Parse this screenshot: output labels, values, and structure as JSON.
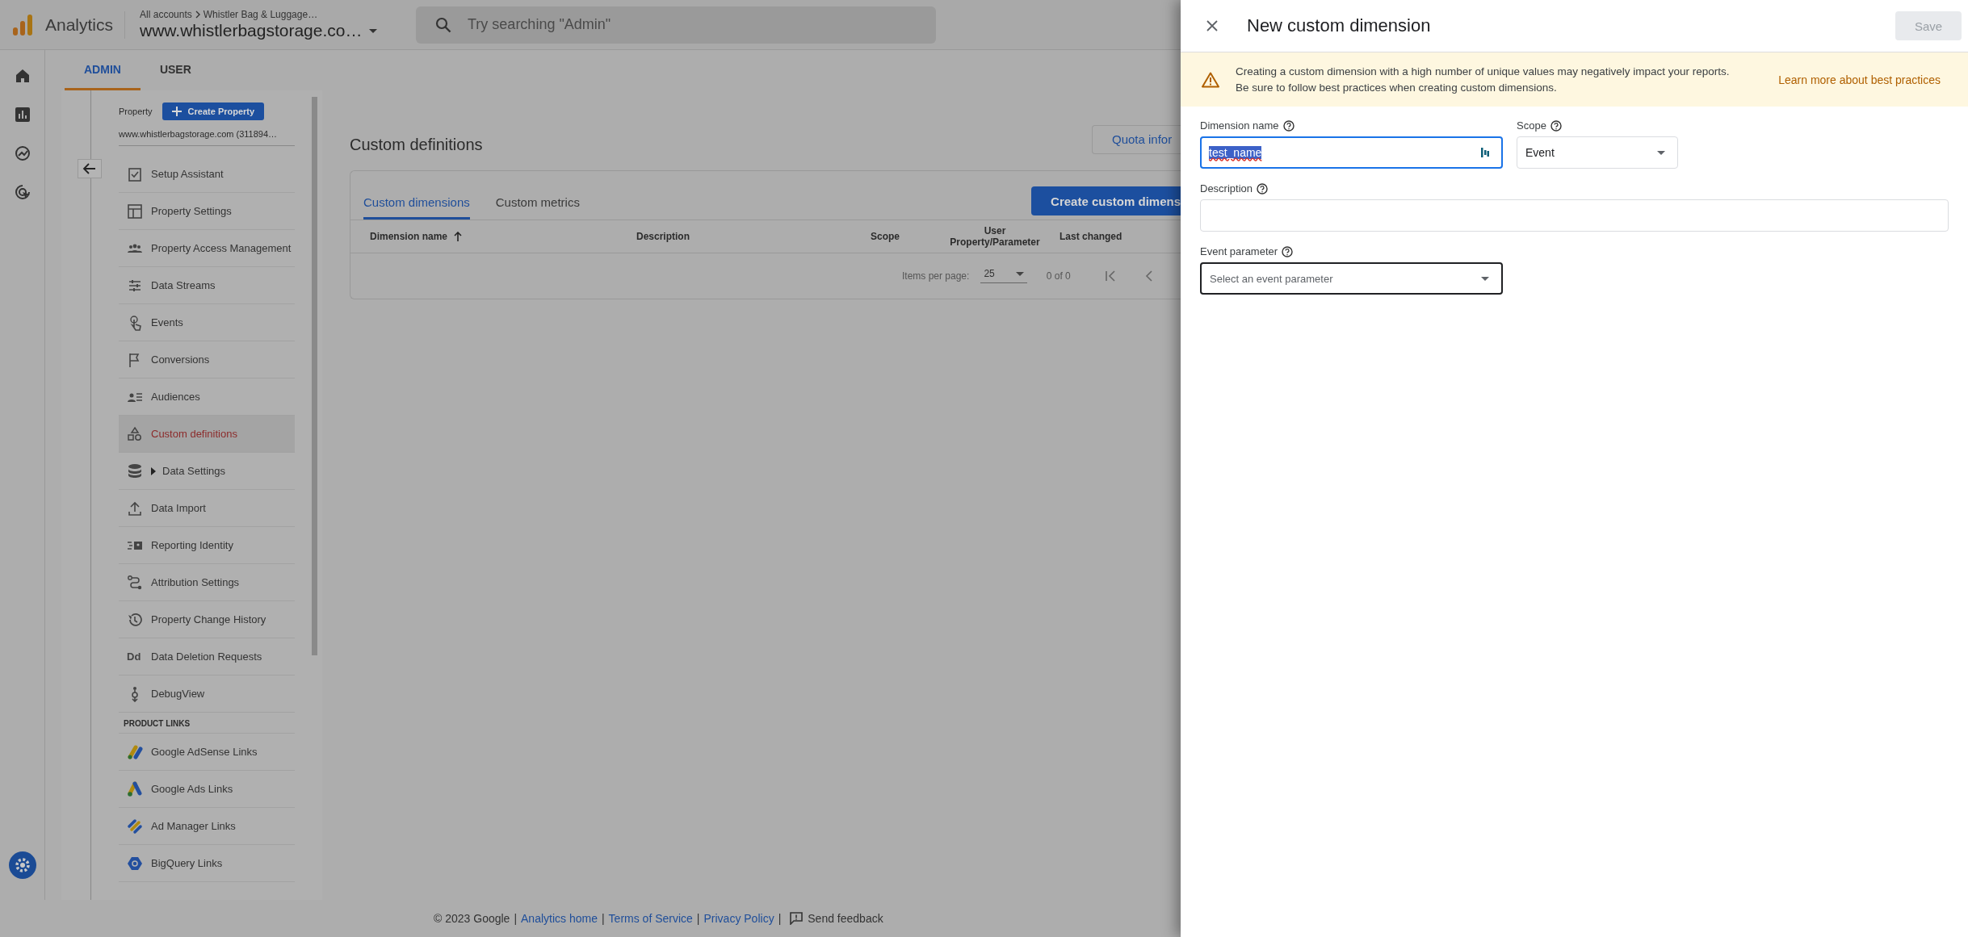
{
  "header": {
    "product": "Analytics",
    "breadcrumb": [
      "All accounts",
      "Whistler Bag & Luggage…"
    ],
    "property": "www.whistlerbagstorage.co…",
    "search": {
      "placeholder": "Try searching \"Admin\""
    }
  },
  "tabs": [
    {
      "label": "ADMIN",
      "selected": true
    },
    {
      "label": "USER",
      "selected": false
    }
  ],
  "sidebar": {
    "property_label": "Property",
    "create_button": "Create Property",
    "property_name": "www.whistlerbagstorage.com (311894…",
    "sections": [
      {
        "items": [
          {
            "label": "Setup Assistant",
            "kind": "page",
            "selected": false
          },
          {
            "label": "Property Settings",
            "kind": "page",
            "selected": false
          },
          {
            "label": "Property Access Management",
            "kind": "page",
            "selected": false
          },
          {
            "label": "Data Streams",
            "kind": "page",
            "selected": false
          },
          {
            "label": "Events",
            "kind": "page",
            "selected": false
          },
          {
            "label": "Conversions",
            "kind": "page",
            "selected": false
          },
          {
            "label": "Audiences",
            "kind": "page",
            "selected": false
          },
          {
            "label": "Custom definitions",
            "kind": "page",
            "selected": true
          },
          {
            "label": "Data Settings",
            "kind": "group",
            "selected": false
          },
          {
            "label": "Data Import",
            "kind": "page",
            "selected": false
          },
          {
            "label": "Reporting Identity",
            "kind": "page",
            "selected": false
          },
          {
            "label": "Attribution Settings",
            "kind": "page",
            "selected": false
          },
          {
            "label": "Property Change History",
            "kind": "page",
            "selected": false
          },
          {
            "label": "Data Deletion Requests",
            "kind": "page",
            "selected": false,
            "icon_text": "Dd"
          },
          {
            "label": "DebugView",
            "kind": "page",
            "selected": false
          }
        ]
      },
      {
        "heading": "PRODUCT LINKS",
        "items": [
          {
            "label": "Google AdSense Links",
            "kind": "link",
            "selected": false
          },
          {
            "label": "Google Ads Links",
            "kind": "link",
            "selected": false
          },
          {
            "label": "Ad Manager Links",
            "kind": "link",
            "selected": false
          },
          {
            "label": "BigQuery Links",
            "kind": "link",
            "selected": false
          }
        ]
      }
    ]
  },
  "main": {
    "title": "Custom definitions",
    "quota_button": "Quota infor",
    "card": {
      "tabs": [
        {
          "label": "Custom dimensions",
          "selected": true
        },
        {
          "label": "Custom metrics",
          "selected": false
        }
      ],
      "create_button": "Create custom dimens",
      "columns": [
        {
          "label": "Dimension name",
          "sorted": true
        },
        {
          "label": "Description",
          "sorted": false
        },
        {
          "label": "Scope",
          "sorted": false
        },
        {
          "label": "User Property/Parameter",
          "sorted": false
        },
        {
          "label": "Last changed",
          "sorted": false
        }
      ],
      "pagination": {
        "label": "Items per page:",
        "value": "25",
        "range": "0 of 0"
      }
    }
  },
  "footer": [
    {
      "kind": "text",
      "text": "© 2023 Google"
    },
    {
      "kind": "separator",
      "text": "|"
    },
    {
      "kind": "link",
      "text": "Analytics home"
    },
    {
      "kind": "separator",
      "text": "|"
    },
    {
      "kind": "link",
      "text": "Terms of Service"
    },
    {
      "kind": "separator",
      "text": "|"
    },
    {
      "kind": "link",
      "text": "Privacy Policy"
    },
    {
      "kind": "separator",
      "text": "|"
    },
    {
      "kind": "feedback",
      "text": "Send feedback"
    }
  ],
  "panel": {
    "title": "New custom dimension",
    "save_button": {
      "label": "Save",
      "disabled": true
    },
    "warning": {
      "text": "Creating a custom dimension with a high number of unique values may negatively impact your reports. Be sure to follow best practices when creating custom dimensions.",
      "link": "Learn more about best practices"
    },
    "rows": [
      [
        {
          "kind": "text",
          "label": "Dimension name",
          "value": "test_name",
          "focused": true,
          "hovered": false,
          "text_selected": true
        },
        {
          "kind": "select",
          "label": "Scope",
          "value": "Event",
          "focused": false,
          "hovered": false
        }
      ],
      [
        {
          "kind": "text",
          "label": "Description",
          "focused": false,
          "hovered": false
        }
      ],
      [
        {
          "kind": "select",
          "label": "Event parameter",
          "placeholder": "Select an event parameter",
          "focused": false,
          "hovered": true
        }
      ]
    ]
  }
}
